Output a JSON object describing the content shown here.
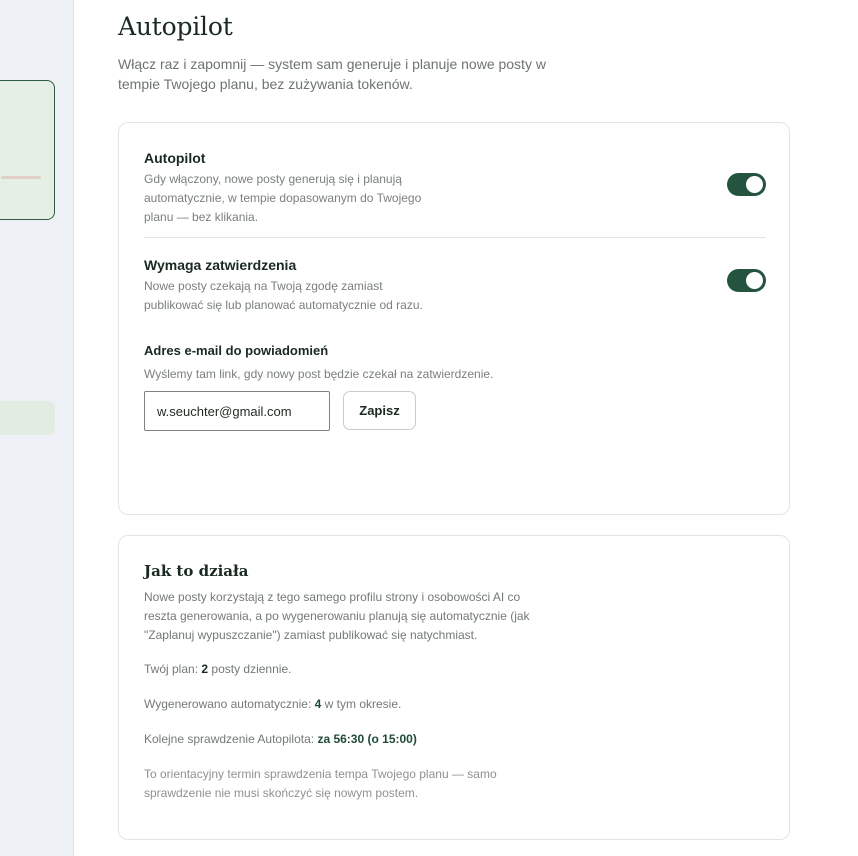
{
  "page": {
    "title": "Autopilot",
    "description": "Włącz raz i zapomnij — system sam generuje i planuje nowe posty w tempie Twojego planu, bez zużywania tokenów."
  },
  "settings": {
    "autopilot": {
      "title": "Autopilot",
      "description": "Gdy włączony, nowe posty generują się i planują automatycznie, w tempie dopasowanym do Twojego planu — bez klikania.",
      "enabled": true
    },
    "approval": {
      "title": "Wymaga zatwierdzenia",
      "description": "Nowe posty czekają na Twoją zgodę zamiast publikować się lub planować automatycznie od razu.",
      "enabled": true
    },
    "email": {
      "label": "Adres e-mail do powiadomień",
      "help": "Wyślemy tam link, gdy nowy post będzie czekał na zatwierdzenie.",
      "value": "w.seuchter@gmail.com",
      "save_label": "Zapisz"
    }
  },
  "info": {
    "title": "Jak to działa",
    "description": "Nowe posty korzystają z tego samego profilu strony i osobowości AI co reszta generowania, a po wygenerowaniu planują się automatycznie (jak \"Zaplanuj wypuszczanie\") zamiast publikować się natychmiast.",
    "plan_prefix": "Twój plan: ",
    "plan_value": "2",
    "plan_suffix": " posty dziennie.",
    "generated_prefix": "Wygenerowano automatycznie: ",
    "generated_value": "4",
    "generated_suffix": " w tym okresie.",
    "next_prefix": "Kolejne sprawdzenie Autopilota: ",
    "next_value": "za 56:30 (o 15:00)",
    "note": "To orientacyjny termin sprawdzenia tempa Twojego planu — samo sprawdzenie nie musi skończyć się nowym postem."
  },
  "colors": {
    "accent": "#245340",
    "background": "#ffffff",
    "sidebar": "#eef2f6"
  }
}
